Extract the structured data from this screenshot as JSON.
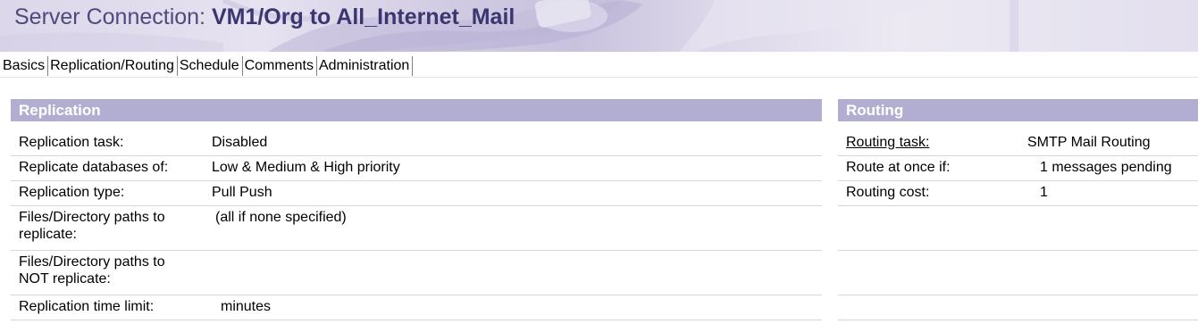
{
  "header": {
    "title_prefix": "Server Connection: ",
    "title_name": "VM1/Org to All_Internet_Mail"
  },
  "tabs": [
    {
      "label": "Basics"
    },
    {
      "label": "Replication/Routing"
    },
    {
      "label": "Schedule"
    },
    {
      "label": "Comments"
    },
    {
      "label": "Administration"
    }
  ],
  "replication": {
    "heading": "Replication",
    "rows": [
      {
        "label": "Replication task:",
        "value": "Disabled"
      },
      {
        "label": "Replicate databases of:",
        "value": "Low & Medium & High priority"
      },
      {
        "label": "Replication type:",
        "value": "Pull Push"
      },
      {
        "label": "Files/Directory paths to replicate:",
        "value": "(all if none specified)"
      },
      {
        "label": "Files/Directory paths to NOT replicate:",
        "value": ""
      },
      {
        "label": "Replication time limit:",
        "value": "minutes"
      }
    ]
  },
  "routing": {
    "heading": "Routing",
    "rows": [
      {
        "label": "Routing task:",
        "value": "SMTP Mail Routing"
      },
      {
        "label": "Route at once if:",
        "value": "1 messages pending"
      },
      {
        "label": "Routing cost:",
        "value": "1"
      }
    ]
  },
  "colors": {
    "section_header": "#b2aed2",
    "title_text": "#4d4a7c"
  }
}
